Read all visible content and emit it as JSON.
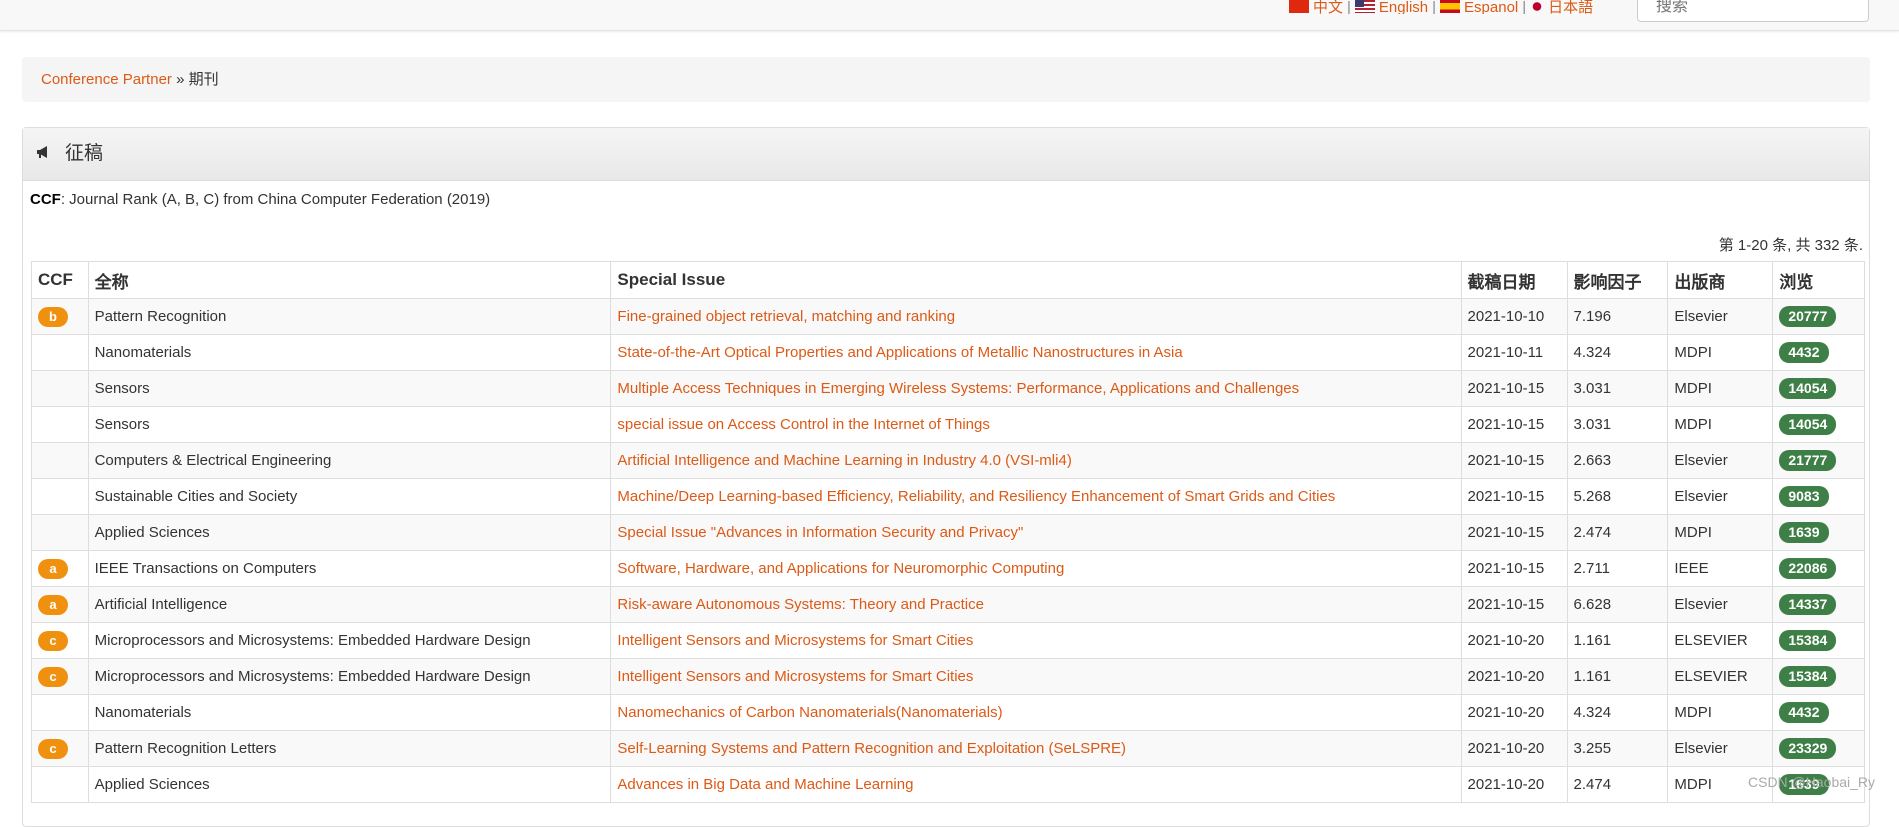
{
  "languages": [
    {
      "label": "中文",
      "flag": "cn-flag-icon"
    },
    {
      "label": "English",
      "flag": "us-flag-icon"
    },
    {
      "label": "Espanol",
      "flag": "es-flag-icon"
    },
    {
      "label": "日本語",
      "flag": "jp-flag-icon"
    }
  ],
  "language_separator": "|",
  "search": {
    "placeholder": "搜索"
  },
  "breadcrumb": {
    "home": "Conference Partner",
    "separator": "»",
    "current": "期刊"
  },
  "panel": {
    "icon": "megaphone-icon",
    "title": "征稿"
  },
  "note": {
    "bold": "CCF",
    "text": ": Journal Rank (A, B, C) from China Computer Federation (2019)"
  },
  "summary": "第 1-20 条, 共 332 条.",
  "table": {
    "headers": [
      "CCF",
      "全称",
      "Special Issue",
      "截稿日期",
      "影响因子",
      "出版商",
      "浏览"
    ],
    "rows": [
      {
        "ccf": "b",
        "name": "Pattern Recognition",
        "issue": "Fine-grained object retrieval, matching and ranking",
        "deadline": "2021-10-10",
        "impact": "7.196",
        "publisher": "Elsevier",
        "views": "20777"
      },
      {
        "ccf": "",
        "name": "Nanomaterials",
        "issue": "State-of-the-Art Optical Properties and Applications of Metallic Nanostructures in Asia",
        "deadline": "2021-10-11",
        "impact": "4.324",
        "publisher": "MDPI",
        "views": "4432"
      },
      {
        "ccf": "",
        "name": "Sensors",
        "issue": "Multiple Access Techniques in Emerging Wireless Systems: Performance, Applications and Challenges",
        "deadline": "2021-10-15",
        "impact": "3.031",
        "publisher": "MDPI",
        "views": "14054"
      },
      {
        "ccf": "",
        "name": "Sensors",
        "issue": "special issue on Access Control in the Internet of Things",
        "deadline": "2021-10-15",
        "impact": "3.031",
        "publisher": "MDPI",
        "views": "14054"
      },
      {
        "ccf": "",
        "name": "Computers & Electrical Engineering",
        "issue": "Artificial Intelligence and Machine Learning in Industry 4.0 (VSI-mli4)",
        "deadline": "2021-10-15",
        "impact": "2.663",
        "publisher": "Elsevier",
        "views": "21777"
      },
      {
        "ccf": "",
        "name": "Sustainable Cities and Society",
        "issue": "Machine/Deep Learning-based Efficiency, Reliability, and Resiliency Enhancement of Smart Grids and Cities",
        "deadline": "2021-10-15",
        "impact": "5.268",
        "publisher": "Elsevier",
        "views": "9083"
      },
      {
        "ccf": "",
        "name": "Applied Sciences",
        "issue": "Special Issue \"Advances in Information Security and Privacy\"",
        "deadline": "2021-10-15",
        "impact": "2.474",
        "publisher": "MDPI",
        "views": "1639"
      },
      {
        "ccf": "a",
        "name": "IEEE Transactions on Computers",
        "issue": "Software, Hardware, and Applications for Neuromorphic Computing",
        "deadline": "2021-10-15",
        "impact": "2.711",
        "publisher": "IEEE",
        "views": "22086"
      },
      {
        "ccf": "a",
        "name": "Artificial Intelligence",
        "issue": "Risk-aware Autonomous Systems: Theory and Practice",
        "deadline": "2021-10-15",
        "impact": "6.628",
        "publisher": "Elsevier",
        "views": "14337"
      },
      {
        "ccf": "c",
        "name": "Microprocessors and Microsystems: Embedded Hardware Design",
        "issue": "Intelligent Sensors and Microsystems for Smart Cities",
        "deadline": "2021-10-20",
        "impact": "1.161",
        "publisher": "ELSEVIER",
        "views": "15384"
      },
      {
        "ccf": "c",
        "name": "Microprocessors and Microsystems: Embedded Hardware Design",
        "issue": "Intelligent Sensors and Microsystems for Smart Cities",
        "deadline": "2021-10-20",
        "impact": "1.161",
        "publisher": "ELSEVIER",
        "views": "15384"
      },
      {
        "ccf": "",
        "name": "Nanomaterials",
        "issue": "Nanomechanics of Carbon Nanomaterials(Nanomaterials)",
        "deadline": "2021-10-20",
        "impact": "4.324",
        "publisher": "MDPI",
        "views": "4432"
      },
      {
        "ccf": "c",
        "name": "Pattern Recognition Letters",
        "issue": "Self-Learning Systems and Pattern Recognition and Exploitation (SeLSPRE)",
        "deadline": "2021-10-20",
        "impact": "3.255",
        "publisher": "Elsevier",
        "views": "23329"
      },
      {
        "ccf": "",
        "name": "Applied Sciences",
        "issue": "Advances in Big Data and Machine Learning",
        "deadline": "2021-10-20",
        "impact": "2.474",
        "publisher": "MDPI",
        "views": "1639"
      }
    ]
  },
  "watermark": "CSDN @Haobai_Ry",
  "colors": {
    "link": "#dd5a16",
    "ccf_badge": "#f0900f",
    "views_badge": "#3d7f46"
  }
}
